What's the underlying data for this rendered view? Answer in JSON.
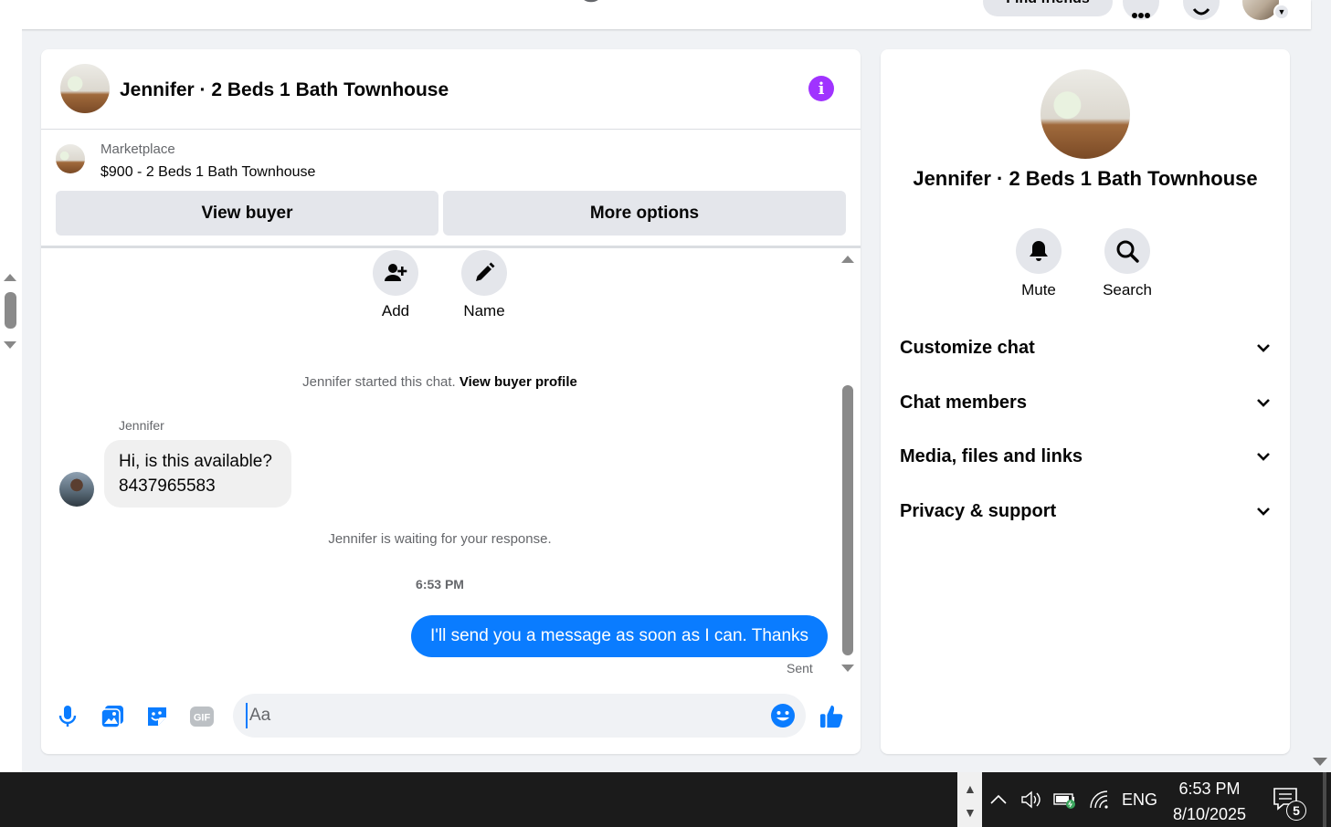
{
  "topbar": {
    "find_friends_label": "Find friends"
  },
  "chat": {
    "title": "Jennifer · 2 Beds 1 Bath Townhouse",
    "info_icon": "i",
    "marketplace": {
      "label": "Marketplace",
      "listing": "$900 - 2 Beds 1 Bath Townhouse",
      "view_buyer_label": "View buyer",
      "more_options_label": "More options"
    },
    "quick_actions": [
      {
        "label": "Add",
        "icon": "add-person-icon"
      },
      {
        "label": "Name",
        "icon": "pencil-icon"
      }
    ],
    "started_text": "Jennifer started this chat.",
    "view_profile_link": "View buyer profile",
    "sender_name": "Jennifer",
    "incoming_message": {
      "line1": "Hi, is this available?",
      "line2": "8437965583"
    },
    "waiting_text": "Jennifer is waiting for your response.",
    "timestamp": "6:53 PM",
    "outgoing_message": "I'll send you a message as soon as I can. Thanks",
    "sent_label": "Sent",
    "composer": {
      "placeholder": "Aa",
      "value": "",
      "icons": [
        "microphone-icon",
        "photo-icon",
        "sticker-icon",
        "gif-icon",
        "emoji-icon",
        "thumbs-up-icon"
      ],
      "gif_text": "GIF"
    }
  },
  "info_panel": {
    "title": "Jennifer · 2 Beds 1 Bath Townhouse",
    "actions": [
      {
        "label": "Mute",
        "icon": "bell-icon"
      },
      {
        "label": "Search",
        "icon": "search-icon"
      }
    ],
    "sections": [
      {
        "label": "Customize chat"
      },
      {
        "label": "Chat members"
      },
      {
        "label": "Media, files and links"
      },
      {
        "label": "Privacy & support"
      }
    ]
  },
  "taskbar": {
    "language": "ENG",
    "time": "6:53 PM",
    "date": "8/10/2025",
    "notification_count": "5"
  },
  "colors": {
    "accent_blue": "#0a7cff",
    "info_purple": "#a033ff",
    "panel_bg": "#ffffff",
    "page_bg": "#f0f2f5"
  }
}
